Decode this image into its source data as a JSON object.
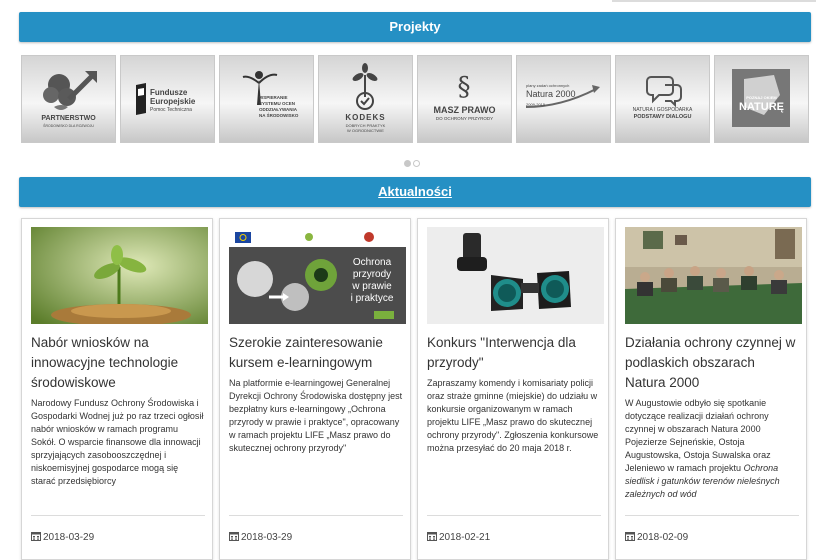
{
  "projekty": {
    "title": "Projekty"
  },
  "projects": [
    {
      "name": "partnerstwo",
      "label": "PARTNERSTWO",
      "sub": "ŚRODOWISKO DLA ROZWOJU"
    },
    {
      "name": "fundusze",
      "label": "Fundusze",
      "label2": "Europejskie",
      "sub": "Pomoc Techniczna"
    },
    {
      "name": "wspieranie",
      "label": "WSPIERANIE",
      "label2": "SYSTEMU OCEN",
      "label3": "ODDZIAŁYWANIA",
      "label4": "NA ŚRODOWISKO"
    },
    {
      "name": "kodeks",
      "label": "KODEKS",
      "sub": "DOBRYCH PRAKTYK",
      "sub2": "W OGRODNICTWIE"
    },
    {
      "name": "masz-prawo",
      "label": "MASZ PRAWO",
      "sub": "DO OCHRONY PRZYRODY"
    },
    {
      "name": "natura2000",
      "label": "plany zadań ochronnych",
      "label2": "Natura 2000",
      "sub": "2009-2015"
    },
    {
      "name": "natura-gospodarka",
      "label": "NATURA I GOSPODARKA",
      "label2": "PODSTAWY DIALOGU"
    },
    {
      "name": "natura",
      "label": "POZNAJ OKIEM",
      "label2": "NATURĘ"
    }
  ],
  "aktualnosci": {
    "title": "Aktualności"
  },
  "news": [
    {
      "title": "Nabór wniosków na innowacyjne technologie środowiskowe",
      "excerpt": "Narodowy Fundusz Ochrony Środowiska i Gospodarki Wodnej już po raz trzeci ogłosił nabór wniosków w ramach programu Sokół. O wsparcie finansowe dla innowacji sprzyjających zasobooszczędnej i niskoemisyjnej gospodarce mogą się starać przedsiębiorcy",
      "date": "2018-03-29"
    },
    {
      "title": "Szerokie zainteresowanie kursem e-learningowym",
      "excerpt": "Na platformie e-learningowej Generalnej Dyrekcji Ochrony Środowiska dostępny jest bezpłatny kurs e-learningowy „Ochrona przyrody w prawie i praktyce\", opracowany w ramach projektu LIFE „Masz prawo do skutecznej ochrony przyrody\"",
      "date": "2018-03-29",
      "thumb_line1": "Ochrona",
      "thumb_line2": "przyrody",
      "thumb_line3": "w prawie",
      "thumb_line4": "i praktyce"
    },
    {
      "title": "Konkurs \"Interwencja dla przyrody\"",
      "excerpt": "Zapraszamy komendy i komisariaty policji oraz straże gminne (miejskie) do udziału w konkursie organizowanym w ramach projektu LIFE „Masz prawo do skutecznej ochrony przyrody\". Zgłoszenia konkursowe można przesyłać do 20 maja 2018 r.",
      "date": "2018-02-21"
    },
    {
      "title": "Działania ochrony czynnej w podlaskich obszarach Natura 2000",
      "excerpt": "W Augustowie odbyło się spotkanie dotyczące realizacji działań ochrony czynnej w obszarach Natura 2000 Pojezierze Sejneńskie, Ostoja Augustowska, Ostoja Suwalska oraz Jeleniewo w ramach projektu ",
      "excerpt_italic": "Ochrona siedlisk i gatunków terenów nieleśnych zależnych od wód",
      "date": "2018-02-09"
    }
  ]
}
